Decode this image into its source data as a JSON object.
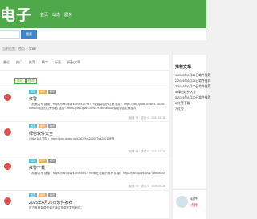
{
  "header": {
    "logo": "电子",
    "nav": [
      "首页",
      "动态",
      "服务"
    ]
  },
  "search": {
    "placeholder": "",
    "button": "搜索"
  },
  "breadcrumb": "当前位置：首页 > 文章？",
  "toolbar": {
    "items": [
      "最近",
      "热门",
      "推荐",
      "精华",
      "标签",
      "所有文章"
    ],
    "tags": [
      "最近",
      "推荐"
    ]
  },
  "cards": [
    {
      "badges": [
        "置顶",
        "推荐",
        "精华"
      ],
      "title": "红警",
      "body": "飞机哦发布 链接：https://pan.quark.cn/s/f1?7f9?7?原始帝国的红警 链接：https://pan.quark.cn/s/b4 7d00d6dfd0c帝国的红警你看 链接：https://pan.quark.cn/s/f7f?a07aa8d9免费帝国红警图片",
      "meta": "阅读 79 · 评论 0 · 2025.06.30"
    },
    {
      "badges": [
        "置顶",
        "推荐",
        "精华"
      ],
      "title": "绿色软件大全",
      "body": "Office365 链接：https://pan.quark.cn/s/a67?b62c090?ba2001 网盘",
      "meta": "阅读 58 · 评论 0 · 2025.06.30"
    },
    {
      "badges": [
        "置顶",
        "推荐",
        "精华"
      ],
      "title": "红警下载",
      "body": "飞机哦发布 链接：https://pan.quark.cn/s/6b07f?hv尚在更新的推荐 链接：https://pan.quark.cn/s/?4bf3ba1c",
      "meta": "阅读 79 · 评论 0 · 2025.06.30"
    },
    {
      "badges": [
        "置顶",
        "推荐",
        "精华"
      ],
      "title": "2025年6月20日软件推荐",
      "body": "官方推荐免费资源正版可免费下载的软件",
      "meta": ""
    }
  ],
  "sidebar": {
    "title": "推荐文章",
    "items": [
      "1.2025年6月24日软件推荐",
      "2.2025年6月23日软件推荐",
      "3.2025年6月20日软件推荐",
      "4.绿色软件大全",
      "5.2025年6月20日软件推荐",
      "6.红警下载",
      "7.红警"
    ],
    "user_name": "软件",
    "user_role": "点我"
  }
}
